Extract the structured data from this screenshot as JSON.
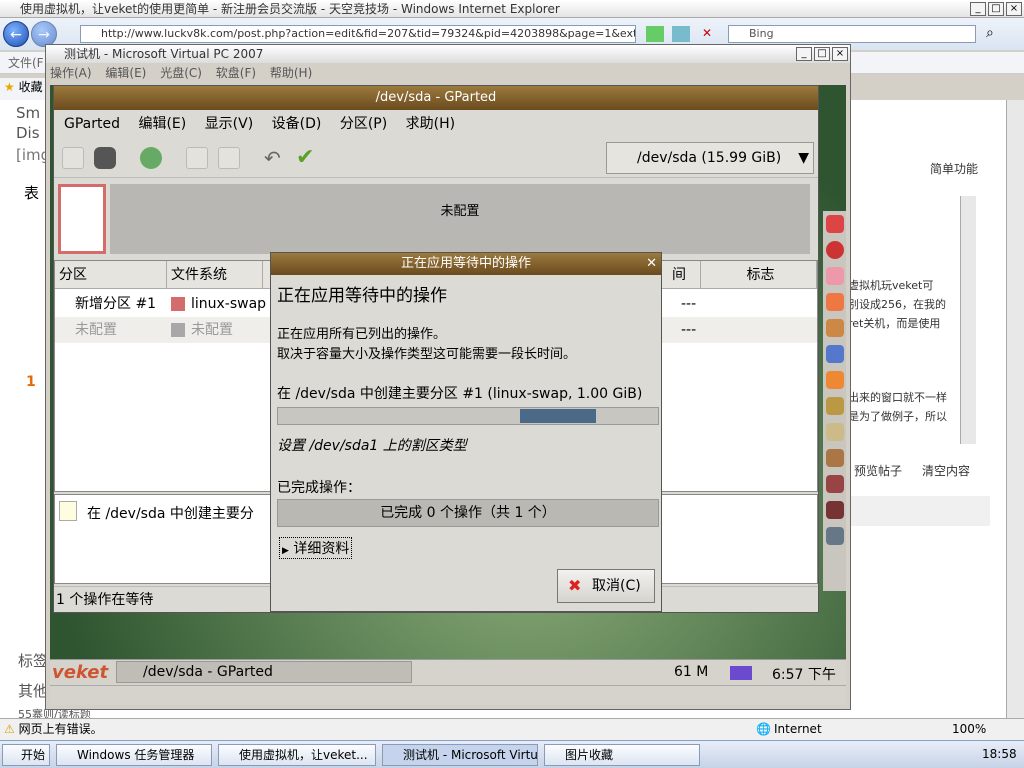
{
  "ie": {
    "title": "使用虚拟机，让veket的使用更简单 - 新注册会员交流版 - 天空竞技场 - Windows Internet Explorer",
    "address": "http://www.luckv8k.com/post.php?action=edit&fid=207&tid=79324&pid=4203898&page=1&extra=page%3",
    "search_placeholder": "Bing",
    "menu_file": "文件(F",
    "fav_label": "收藏",
    "status_text": "网页上有错误。",
    "zone": "Internet",
    "zoom": "100%"
  },
  "webpage": {
    "left_frag1": "Sm",
    "left_frag2": "Dis",
    "left_frag3": "[img",
    "left_frag4": "表",
    "left_frag5": "1",
    "left_frag6": "标签",
    "left_frag7": "其他",
    "left_frag8": "55寨则/读标题",
    "simple_func": "简单功能",
    "text1": "虚拟机玩veket可",
    "text2": "别设成256，在我的",
    "text3": "ret关机，而是使用",
    "text4": "出来的窗口就不一样",
    "text5": "是为了做例子，所以",
    "preview_btn": "预览帖子",
    "clear_btn": "清空内容"
  },
  "taskbar": {
    "start": "开始",
    "items": [
      "Windows 任务管理器",
      "使用虚拟机，让veket...",
      "测试机 - Microsoft Virtu...",
      "图片收藏"
    ],
    "clock": "18:58"
  },
  "vpc": {
    "title": "测试机 - Microsoft Virtual PC 2007",
    "menu": [
      "操作(A)",
      "编辑(E)",
      "光盘(C)",
      "软盘(F)",
      "帮助(H)"
    ]
  },
  "gparted": {
    "title": "/dev/sda - GParted",
    "menu": [
      "GParted",
      "编辑(E)",
      "显示(V)",
      "设备(D)",
      "分区(P)",
      "求助(H)"
    ],
    "device": "/dev/sda  (15.99 GiB)",
    "unallocated_graph": "未配置",
    "columns": [
      "分区",
      "文件系统",
      "间",
      "标志"
    ],
    "rows": [
      {
        "partition": "新增分区 #1",
        "fs": "linux-swap",
        "flags": "---",
        "color": "#d46c6c"
      },
      {
        "partition": "未配置",
        "fs": "未配置",
        "flags": "---",
        "color": "#a8a8a8"
      }
    ],
    "pending_op": "在 /dev/sda 中创建主要分",
    "status": "1 个操作在等待"
  },
  "dialog": {
    "title": "正在应用等待中的操作",
    "heading": "正在应用等待中的操作",
    "line1": "正在应用所有已列出的操作。",
    "line2": "取决于容量大小及操作类型这可能需要一段长时间。",
    "current_op": "在 /dev/sda 中创建主要分区 #1 (linux-swap, 1.00 GiB)",
    "sub_op": "设置 /dev/sda1 上的割区类型",
    "completed_label": "已完成操作：",
    "completed_bar": "已完成 0 个操作（共 1 个）",
    "details": "详细资料",
    "cancel": "取消(C)",
    "progress": 0.2
  },
  "guest": {
    "logo": "veket",
    "task": "/dev/sda - GParted",
    "mem": "61 M",
    "clock": "6:57 下午"
  }
}
